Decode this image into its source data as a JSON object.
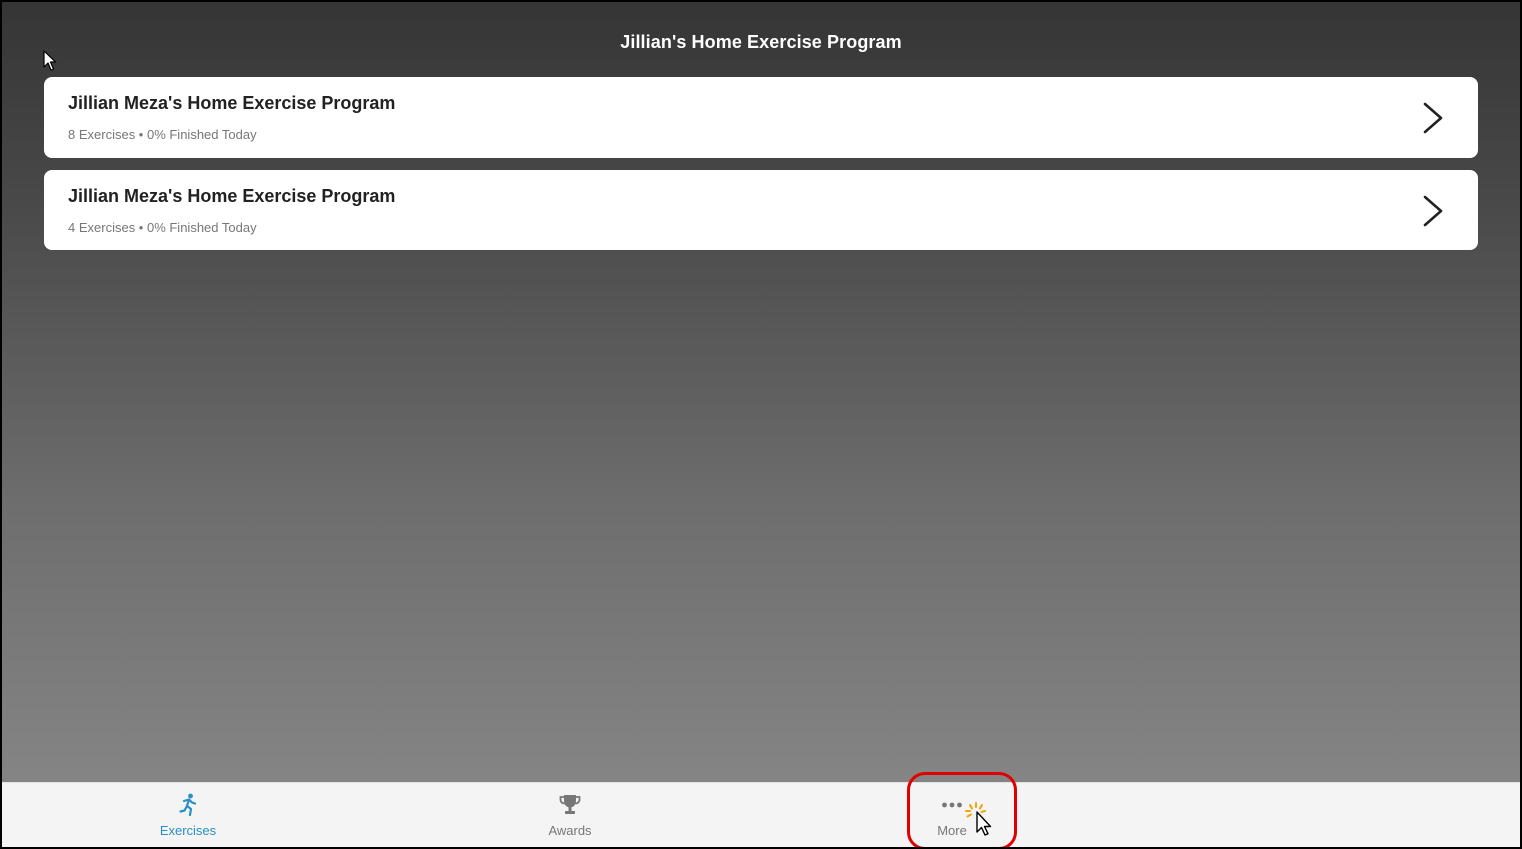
{
  "header": {
    "title": "Jillian's Home Exercise Program"
  },
  "programs": [
    {
      "title": "Jillian Meza's Home Exercise Program",
      "meta": "8 Exercises • 0% Finished Today",
      "icon": "chevron-right-icon"
    },
    {
      "title": "Jillian Meza's Home Exercise Program",
      "meta": "4 Exercises • 0% Finished Today",
      "icon": "chevron-right-icon"
    }
  ],
  "tab_bar": {
    "tabs": [
      {
        "label": "Exercises",
        "icon": "running-person-icon",
        "active": true
      },
      {
        "label": "Awards",
        "icon": "trophy-icon",
        "active": false
      },
      {
        "label": "More",
        "icon": "more-dots-icon",
        "active": false
      }
    ]
  },
  "colors": {
    "active_tab": "#2a8fc4",
    "inactive_tab": "#777777",
    "highlight_ring": "#e10000",
    "card_background": "#ffffff"
  }
}
